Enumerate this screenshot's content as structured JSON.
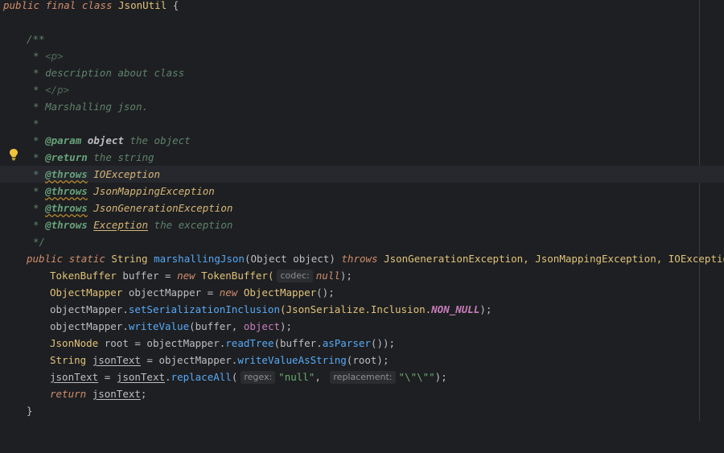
{
  "code": {
    "l1": {
      "kw1": "public",
      "kw2": "final",
      "kw3": "class",
      "name": "JsonUtil",
      "brace": "{"
    },
    "l3": {
      "text": "/**"
    },
    "l4": {
      "star": "*",
      "tag": "<p>"
    },
    "l5": {
      "star": "*",
      "text": "description about class"
    },
    "l6": {
      "star": "*",
      "tag": "</p>"
    },
    "l7": {
      "star": "*",
      "text": "Marshalling json."
    },
    "l8": {
      "star": "*"
    },
    "l9": {
      "star": "*",
      "tag": "@param",
      "param": "object",
      "text": "the object"
    },
    "l10": {
      "star": "*",
      "tag": "@return",
      "text": "the string"
    },
    "l11": {
      "star": "*",
      "tag": "@throws",
      "ref": "IOException"
    },
    "l12": {
      "star": "*",
      "tag": "@throws",
      "ref": "JsonMappingException"
    },
    "l13": {
      "star": "*",
      "tag": "@throws",
      "ref": "JsonGenerationException"
    },
    "l14": {
      "star": "*",
      "tag": "@throws",
      "ref": "Exception",
      "text": "the exception"
    },
    "l15": {
      "text": "*/"
    },
    "l16": {
      "kw1": "public",
      "kw2": "static",
      "ret": "String",
      "fn": "marshallingJson",
      "p1": "(Object ",
      "pname": "object",
      "p2": ")",
      "kw3": "throws",
      "ex": "JsonGenerationException, JsonMappingException, IOException {"
    },
    "l17": {
      "type": "TokenBuffer",
      "var": " buffer = ",
      "kw": "new",
      "ctor": " TokenBuffer(",
      "hint": "codec:",
      "nul": "null",
      "end": ");"
    },
    "l18": {
      "type": "ObjectMapper",
      "var": " objectMapper = ",
      "kw": "new",
      "ctor": " ObjectMapper",
      "end": "();"
    },
    "l19": {
      "obj": "objectMapper.",
      "m": "setSerializationInclusion",
      "a1": "(JsonSerialize.",
      "a2": "Inclusion.",
      "c": "NON_NULL",
      "end": ");"
    },
    "l20": {
      "obj": "objectMapper.",
      "m": "writeValue",
      "a1": "(buffer, ",
      "p": "object",
      "end": ");"
    },
    "l21": {
      "type": "JsonNode",
      "var": " root = objectMapper.",
      "m": "readTree",
      "a1": "(buffer.",
      "m2": "asParser",
      "end": "());"
    },
    "l22": {
      "type": "String",
      "v": "jsonText",
      "eq": " = objectMapper.",
      "m": "writeValueAsString",
      "end": "(root);"
    },
    "l23": {
      "v1": "jsonText",
      "eq": " = ",
      "v2": "jsonText",
      "dot": ".",
      "m": "replaceAll",
      "op": "(",
      "h1": "regex:",
      "s1": "\"null\"",
      "comma": ", ",
      "h2": "replacement:",
      "s2": "\"\\\"\\\"\"",
      "end": ");"
    },
    "l24": {
      "kw": "return",
      "v": "jsonText",
      "end": ";"
    },
    "l25": {
      "brace": "}"
    }
  },
  "icons": {
    "gutter": "lightbulb-icon"
  },
  "colors": {
    "background": "#1e1f22",
    "keyword": "#cf8e6d",
    "string": "#6aab73",
    "method": "#56a8f5",
    "comment": "#5f826b"
  }
}
